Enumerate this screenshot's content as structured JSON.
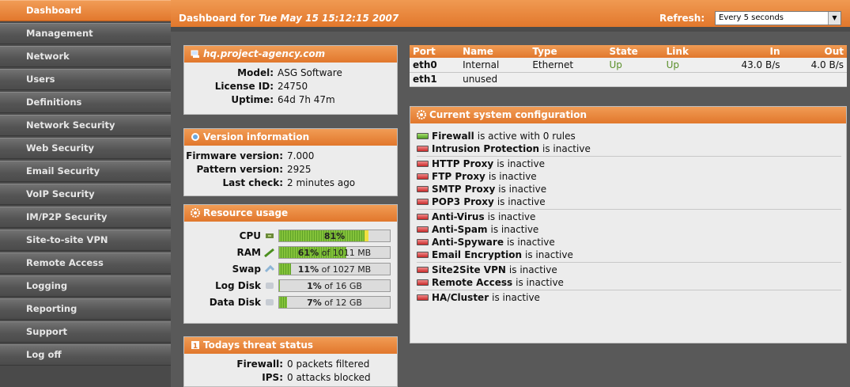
{
  "nav": [
    {
      "label": "Dashboard",
      "active": true
    },
    {
      "label": "Management"
    },
    {
      "label": "Network"
    },
    {
      "label": "Users"
    },
    {
      "label": "Definitions"
    },
    {
      "label": "Network Security"
    },
    {
      "label": "Web Security"
    },
    {
      "label": "Email Security"
    },
    {
      "label": "VoIP Security"
    },
    {
      "label": "IM/P2P Security"
    },
    {
      "label": "Site-to-site VPN"
    },
    {
      "label": "Remote Access"
    },
    {
      "label": "Logging"
    },
    {
      "label": "Reporting"
    },
    {
      "label": "Support"
    },
    {
      "label": "Log off"
    }
  ],
  "header": {
    "title_prefix": "Dashboard for",
    "title_date": "Tue May 15 15:12:15 2007",
    "refresh_label": "Refresh:",
    "refresh_value": "Every 5 seconds"
  },
  "host": {
    "hostname": "hq.project-agency.com",
    "model_label": "Model:",
    "model": "ASG Software",
    "license_label": "License ID:",
    "license": "24750",
    "uptime_label": "Uptime:",
    "uptime": "64d 7h 47m"
  },
  "version": {
    "title": "Version information",
    "firmware_label": "Firmware version:",
    "firmware": "7.000",
    "pattern_label": "Pattern version:",
    "pattern": "2925",
    "lastcheck_label": "Last check:",
    "lastcheck": "2 minutes ago"
  },
  "resources": {
    "title": "Resource usage",
    "items": [
      {
        "label": "CPU",
        "pct_text": "81%",
        "suffix": "",
        "fraction": 0.81
      },
      {
        "label": "RAM",
        "pct_text": "61%",
        "suffix": " of 1011 MB",
        "fraction": 0.61
      },
      {
        "label": "Swap",
        "pct_text": "11%",
        "suffix": " of 1027 MB",
        "fraction": 0.11
      },
      {
        "label": "Log Disk",
        "pct_text": "1%",
        "suffix": " of 16 GB",
        "fraction": 0.01
      },
      {
        "label": "Data Disk",
        "pct_text": "7%",
        "suffix": " of 12 GB",
        "fraction": 0.07
      }
    ]
  },
  "threat": {
    "title": "Todays threat status",
    "firewall_label": "Firewall:",
    "firewall": "0 packets filtered",
    "ips_label": "IPS:",
    "ips": "0 attacks blocked"
  },
  "interfaces": {
    "headers": [
      "Port",
      "Name",
      "Type",
      "State",
      "Link",
      "In",
      "Out"
    ],
    "rows": [
      [
        "eth0",
        "Internal",
        "Ethernet",
        "Up",
        "Up",
        "43.0 B/s",
        "4.0 B/s"
      ],
      [
        "eth1",
        "unused",
        "",
        "",
        "",
        "",
        ""
      ]
    ]
  },
  "config": {
    "title": "Current system configuration",
    "groups": [
      [
        {
          "name": "Firewall",
          "status": "is active with 0 rules",
          "on": true
        },
        {
          "name": "Intrusion Protection",
          "status": "is inactive",
          "on": false
        }
      ],
      [
        {
          "name": "HTTP Proxy",
          "status": "is inactive",
          "on": false
        },
        {
          "name": "FTP Proxy",
          "status": "is inactive",
          "on": false
        },
        {
          "name": "SMTP Proxy",
          "status": "is inactive",
          "on": false
        },
        {
          "name": "POP3 Proxy",
          "status": "is inactive",
          "on": false
        }
      ],
      [
        {
          "name": "Anti-Virus",
          "status": "is inactive",
          "on": false
        },
        {
          "name": "Anti-Spam",
          "status": "is inactive",
          "on": false
        },
        {
          "name": "Anti-Spyware",
          "status": "is inactive",
          "on": false
        },
        {
          "name": "Email Encryption",
          "status": "is inactive",
          "on": false
        }
      ],
      [
        {
          "name": "Site2Site VPN",
          "status": "is inactive",
          "on": false
        },
        {
          "name": "Remote Access",
          "status": "is inactive",
          "on": false
        }
      ],
      [
        {
          "name": "HA/Cluster",
          "status": "is inactive",
          "on": false
        }
      ]
    ]
  },
  "colors": {
    "accent": "#e67f31",
    "sidebar": "#4a4a4a",
    "led_on": "#5fa228",
    "led_off": "#c92a2a"
  }
}
